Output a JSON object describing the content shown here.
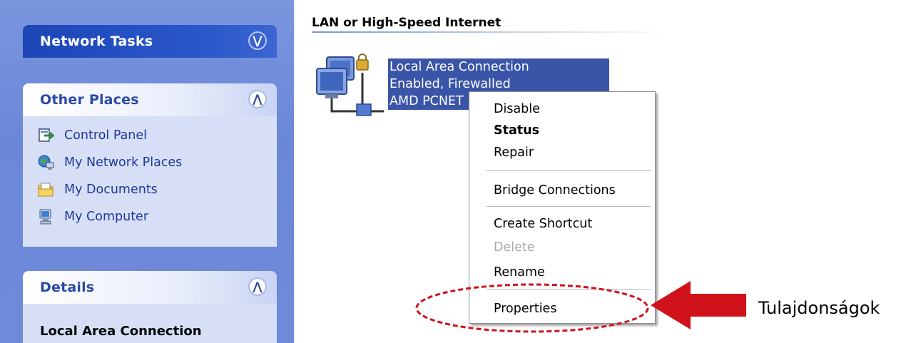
{
  "taskpane": {
    "network_tasks": {
      "title": "Network Tasks",
      "chevron": "expand-chevron-icon"
    },
    "other_places": {
      "title": "Other Places",
      "chevron": "collapse-chevron-icon",
      "items": [
        {
          "label": "Control Panel",
          "icon": "control-panel-icon"
        },
        {
          "label": "My Network Places",
          "icon": "network-places-icon"
        },
        {
          "label": "My Documents",
          "icon": "documents-folder-icon"
        },
        {
          "label": "My Computer",
          "icon": "computer-icon"
        }
      ]
    },
    "details": {
      "title": "Details",
      "chevron": "collapse-chevron-icon",
      "name": "Local Area Connection"
    }
  },
  "content": {
    "section_title": "LAN or High-Speed Internet",
    "connection": {
      "line1": "Local Area Connection",
      "line2": "Enabled, Firewalled",
      "line3": "AMD PCNET"
    }
  },
  "context_menu": {
    "items": [
      {
        "label": "Disable",
        "style": "normal"
      },
      {
        "label": "Status",
        "style": "bold"
      },
      {
        "label": "Repair",
        "style": "normal"
      },
      {
        "label": "Bridge Connections",
        "style": "normal"
      },
      {
        "label": "Create Shortcut",
        "style": "normal"
      },
      {
        "label": "Delete",
        "style": "disabled"
      },
      {
        "label": "Rename",
        "style": "normal"
      },
      {
        "label": "Properties",
        "style": "normal"
      }
    ]
  },
  "annotation": {
    "label": "Tulajdonságok",
    "arrow_color": "#d0121b",
    "ellipse_color": "#d0121b"
  },
  "colors": {
    "taskpane_bg": "#6f8ad9",
    "selection_bg": "#3a54a8",
    "header_dark": "#1d46b7"
  }
}
